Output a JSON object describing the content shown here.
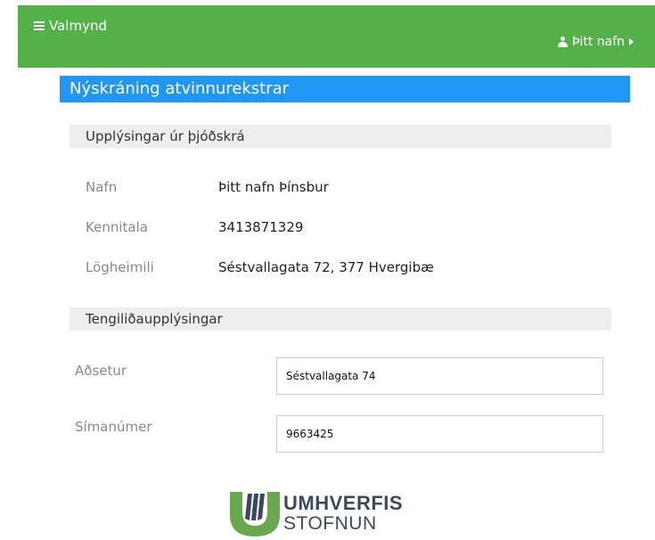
{
  "header": {
    "menu_label": "Valmynd",
    "user_label": "Þitt nafn",
    "bar_color": "#54b14a"
  },
  "page": {
    "title": "Nýskráning atvinnurekstrar",
    "title_color": "#2196f3"
  },
  "registry_section": {
    "heading": "Upplýsingar úr þjóðskrá",
    "fields": [
      {
        "label": "Nafn",
        "value": "Þitt nafn Þínsbur"
      },
      {
        "label": "Kennitala",
        "value": "3413871329"
      },
      {
        "label": "Lögheimili",
        "value": "Séstvallagata 72, 377 Hvergibæ"
      }
    ]
  },
  "contact_section": {
    "heading": "Tengiliðaupplýsingar",
    "fields": [
      {
        "label": "Aðsetur",
        "value": "Séstvallagata 74"
      },
      {
        "label": "Símanúmer",
        "value": "9663425"
      }
    ]
  },
  "logo": {
    "line1": "UMHVERFIS",
    "line2": "STOFNUN"
  },
  "icons": [
    "hamburger-icon",
    "user-icon",
    "caret-right-icon",
    "logo-mark-icon"
  ]
}
